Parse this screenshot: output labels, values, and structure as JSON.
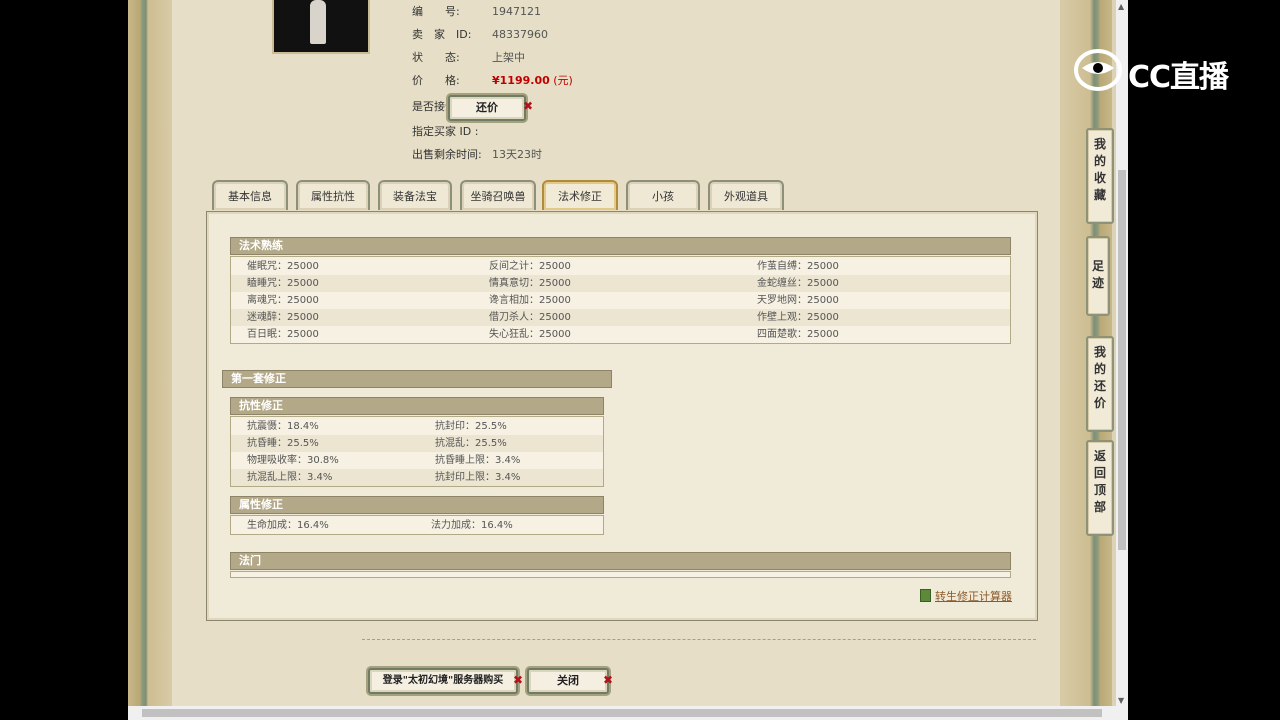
{
  "item": {
    "number_label": "编　　号:",
    "number_value": "1947121",
    "seller_label": "卖　家　ID:",
    "seller_value": "48337960",
    "status_label": "状　　态:",
    "status_value": "上架中",
    "price_label": "价　　格:",
    "price_value": "¥1199.00",
    "price_unit": "(元)",
    "counter_label": "是否接受还价:",
    "counter_button": "还价",
    "buyer_label": "指定买家 ID :",
    "buyer_value": "",
    "remaining_label": "出售剩余时间:",
    "remaining_value": "13天23时"
  },
  "tabs": [
    "基本信息",
    "属性抗性",
    "装备法宝",
    "坐骑召唤兽",
    "法术修正",
    "小孩",
    "外观道具"
  ],
  "active_tab": "法术修正",
  "spell_mastery": {
    "title": "法术熟练",
    "rows": [
      [
        "催眠咒：25000",
        "反间之计：25000",
        "作茧自缚：25000"
      ],
      [
        "瞌睡咒：25000",
        "情真意切：25000",
        "金蛇缠丝：25000"
      ],
      [
        "离魂咒：25000",
        "谗言相加：25000",
        "天罗地网：25000"
      ],
      [
        "迷魂醉：25000",
        "借刀杀人：25000",
        "作壁上观：25000"
      ],
      [
        "百日眠：25000",
        "失心狂乱：25000",
        "四面楚歌：25000"
      ]
    ]
  },
  "set1": {
    "title": "第一套修正",
    "resist": {
      "title": "抗性修正",
      "rows": [
        [
          "抗震慑：18.4%",
          "抗封印：25.5%"
        ],
        [
          "抗昏睡：25.5%",
          "抗混乱：25.5%"
        ],
        [
          "物理吸收率：30.8%",
          "抗昏睡上限：3.4%"
        ],
        [
          "抗混乱上限：3.4%",
          "抗封印上限：3.4%"
        ]
      ]
    },
    "attr": {
      "title": "属性修正",
      "rows": [
        [
          "生命加成：16.4%",
          "法力加成：16.4%"
        ]
      ]
    }
  },
  "faction": {
    "title": "法门"
  },
  "calc_link": "转生修正计算器",
  "bottom_buttons": {
    "buy": "登录\"太初幻境\"服务器购买",
    "close": "关闭"
  },
  "sidenav": {
    "favorites": [
      "我",
      "的",
      "收",
      "藏"
    ],
    "footprint": [
      "足",
      "迹"
    ],
    "my_offers": [
      "我",
      "的",
      "还",
      "价"
    ],
    "top": [
      "返",
      "回",
      "顶",
      "部"
    ]
  },
  "logo": {
    "text": "CC直播",
    "icon": "cc-logo-icon"
  },
  "colors": {
    "price": "#c00000",
    "header": "#b3a887",
    "close_x": "#b2121c"
  }
}
